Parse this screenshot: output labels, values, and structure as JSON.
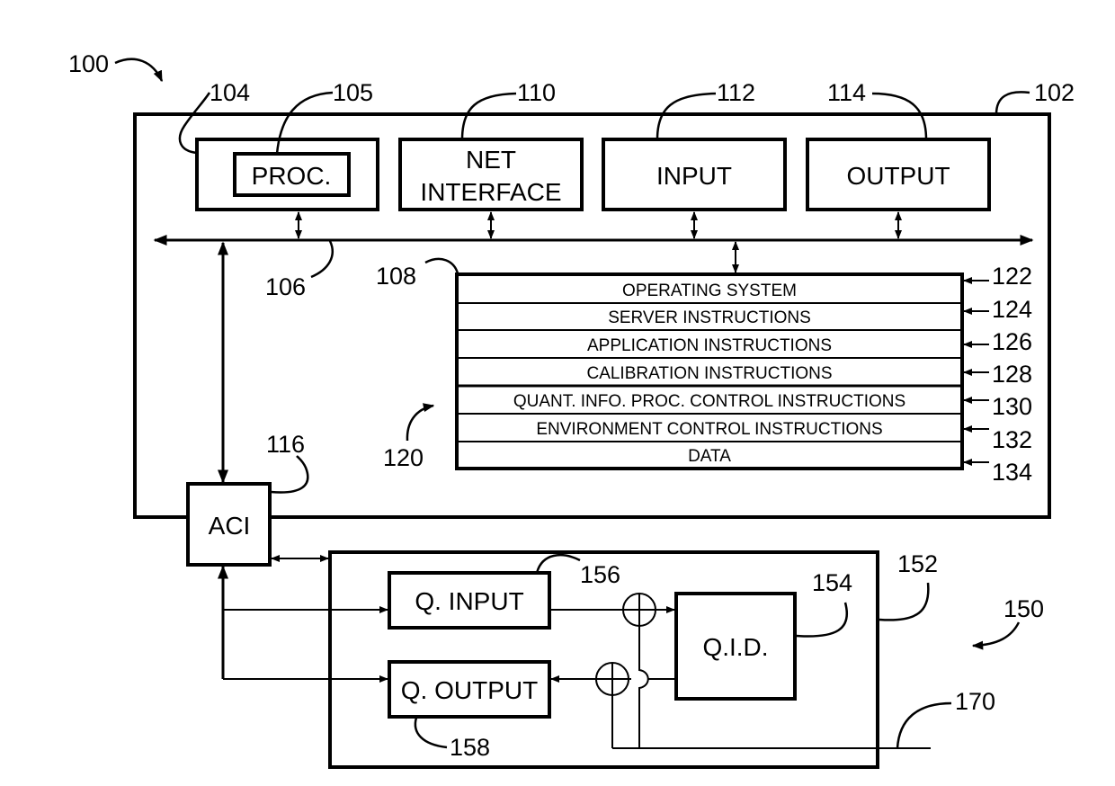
{
  "figure": {
    "system_ref": "100",
    "quantum_system_ref": "150"
  },
  "computer": {
    "ref": "102",
    "bus_ref": "106",
    "components": [
      {
        "id": "processor-module",
        "ref": "104",
        "label": ""
      },
      {
        "id": "processor",
        "ref": "105",
        "label": "PROC."
      },
      {
        "id": "net-interface",
        "ref": "110",
        "label_lines": [
          "NET",
          "INTERFACE"
        ]
      },
      {
        "id": "input",
        "ref": "112",
        "label": "INPUT"
      },
      {
        "id": "output",
        "ref": "114",
        "label": "OUTPUT"
      }
    ],
    "aci": {
      "ref": "116",
      "label": "ACI"
    },
    "memory": {
      "ref": "108",
      "group_ref": "120",
      "rows": [
        {
          "label": "OPERATING SYSTEM",
          "ref": "122"
        },
        {
          "label": "SERVER INSTRUCTIONS",
          "ref": "124"
        },
        {
          "label": "APPLICATION INSTRUCTIONS",
          "ref": "126"
        },
        {
          "label": "CALIBRATION INSTRUCTIONS",
          "ref": "128"
        },
        {
          "label": "QUANT. INFO. PROC. CONTROL INSTRUCTIONS",
          "ref": "130"
        },
        {
          "label": "ENVIRONMENT CONTROL INSTRUCTIONS",
          "ref": "132"
        },
        {
          "label": "DATA",
          "ref": "134"
        }
      ]
    }
  },
  "quantum": {
    "ref": "152",
    "q_input": {
      "ref": "156",
      "label": "Q. INPUT"
    },
    "q_output": {
      "ref": "158",
      "label": "Q. OUTPUT"
    },
    "qid": {
      "ref": "154",
      "label": "Q.I.D."
    },
    "line_ref": "170"
  }
}
